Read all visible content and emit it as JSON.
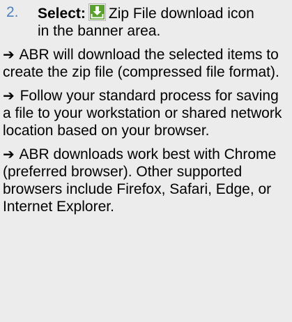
{
  "step": {
    "number": "2.",
    "label": "Select:",
    "icon": "download-zip-icon",
    "text": "Zip File download icon in the banner area."
  },
  "bullets": [
    {
      "arrow": "➔",
      "text": "ABR will download the selected items to create the zip file (compressed file format)."
    },
    {
      "arrow": "➔",
      "text": "Follow your standard process for saving a file to your workstation or shared network location based on your browser."
    },
    {
      "arrow": "➔",
      "text": "ABR downloads work best with Chrome (preferred browser). Other supported browsers include Firefox, Safari, Edge, or Internet Explorer."
    }
  ],
  "colors": {
    "background": "#ececec",
    "text": "#000000",
    "step_number": "#4f81bd",
    "icon_green": "#5aa02c",
    "icon_border": "#b0b0b0"
  }
}
